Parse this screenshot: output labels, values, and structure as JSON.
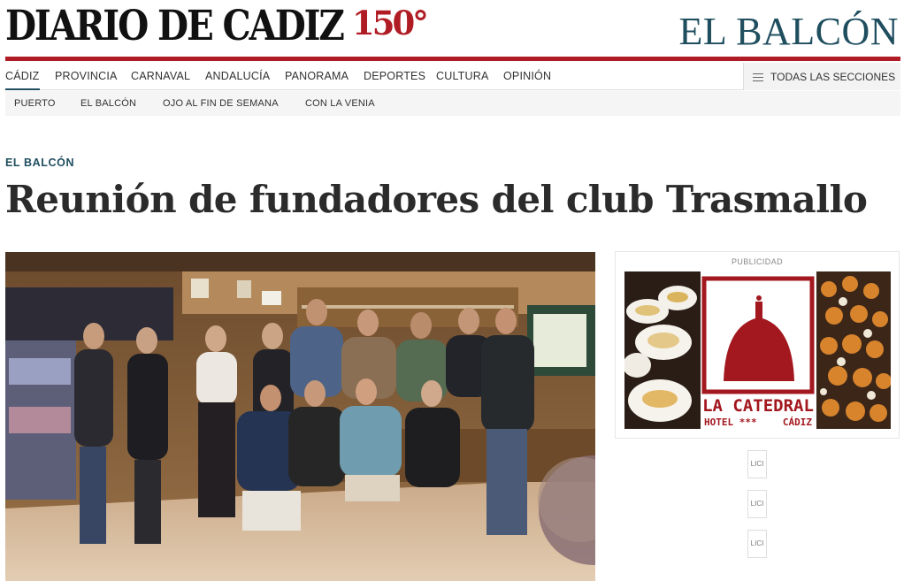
{
  "masthead": {
    "brand": "DIARIO DE CADIZ",
    "anniversary": "150°",
    "section": "EL BALCÓN"
  },
  "nav": {
    "primary": [
      "CÁDIZ",
      "PROVINCIA",
      "CARNAVAL",
      "ANDALUCÍA",
      "PANORAMA",
      "DEPORTES",
      "CULTURA",
      "OPINIÓN"
    ],
    "active": "CÁDIZ",
    "all_sections": "TODAS LAS SECCIONES",
    "secondary": [
      "PUERTO",
      "EL BALCÓN",
      "OJO AL FIN DE SEMANA",
      "CON LA VENIA"
    ]
  },
  "article": {
    "kicker": "EL BALCÓN",
    "headline": "Reunión de fundadores del club Trasmallo"
  },
  "ad": {
    "label": "PUBLICIDAD",
    "logo_name": "LA CATEDRAL",
    "logo_sub_left": "HOTEL ***",
    "logo_sub_right": "CÁDIZ",
    "mini_labels": [
      "LICI",
      "LICI",
      "LICI"
    ]
  },
  "colors": {
    "brand_red": "#b01c24",
    "section_blue": "#1f4e5f"
  }
}
